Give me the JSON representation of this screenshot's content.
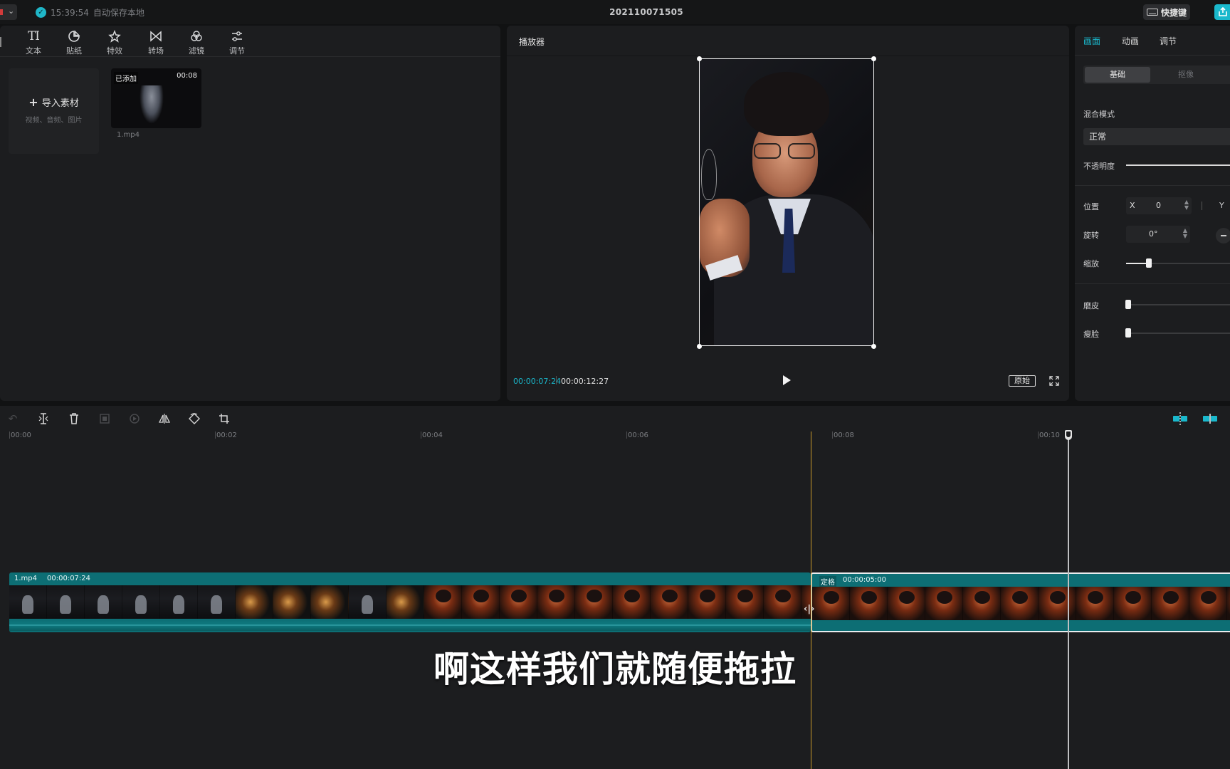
{
  "topbar": {
    "save_time": "15:39:54",
    "save_text": "自动保存本地",
    "project_title": "202110071505",
    "shortcut_label": "快捷键"
  },
  "media_tools": [
    {
      "label": "文本",
      "icon": "text-icon"
    },
    {
      "label": "贴纸",
      "icon": "sticker-icon"
    },
    {
      "label": "特效",
      "icon": "effects-icon"
    },
    {
      "label": "转场",
      "icon": "transition-icon"
    },
    {
      "label": "滤镜",
      "icon": "filter-icon"
    },
    {
      "label": "调节",
      "icon": "adjust-icon"
    }
  ],
  "media": {
    "import_label": "导入素材",
    "import_hint": "视频、音频、图片",
    "item": {
      "badge": "已添加",
      "duration": "00:08",
      "name": "1.mp4"
    }
  },
  "player": {
    "title": "播放器",
    "current_time": "00:00:07:24",
    "total_time": "00:00:12:27",
    "ratio_label": "原始"
  },
  "props": {
    "tabs": [
      "画面",
      "动画",
      "调节"
    ],
    "active_tab": "画面",
    "segments": [
      "基础",
      "抠像"
    ],
    "blend_mode_label": "混合模式",
    "blend_mode_value": "正常",
    "opacity_label": "不透明度",
    "position_label": "位置",
    "position_x_axis": "X",
    "position_x": "0",
    "position_y_axis": "Y",
    "rotation_label": "旋转",
    "rotation_value": "0°",
    "scale_label": "缩放",
    "scale_fraction": 0.2,
    "smooth_label": "磨皮",
    "smooth_fraction": 0.0,
    "slim_label": "瘦脸",
    "slim_fraction": 0.0
  },
  "timeline": {
    "ticks": [
      "00:00",
      "00:02",
      "00:04",
      "00:06",
      "00:08",
      "00:10"
    ],
    "clips": [
      {
        "name": "1.mp4",
        "duration": "00:00:07:24"
      },
      {
        "name": "定格",
        "duration": "00:00:05:00"
      }
    ]
  },
  "subtitle": "啊这样我们就随便拖拉",
  "colors": {
    "accent": "#1ab8cc",
    "clip": "#0d6e74",
    "hover_line": "#c99a2a"
  }
}
